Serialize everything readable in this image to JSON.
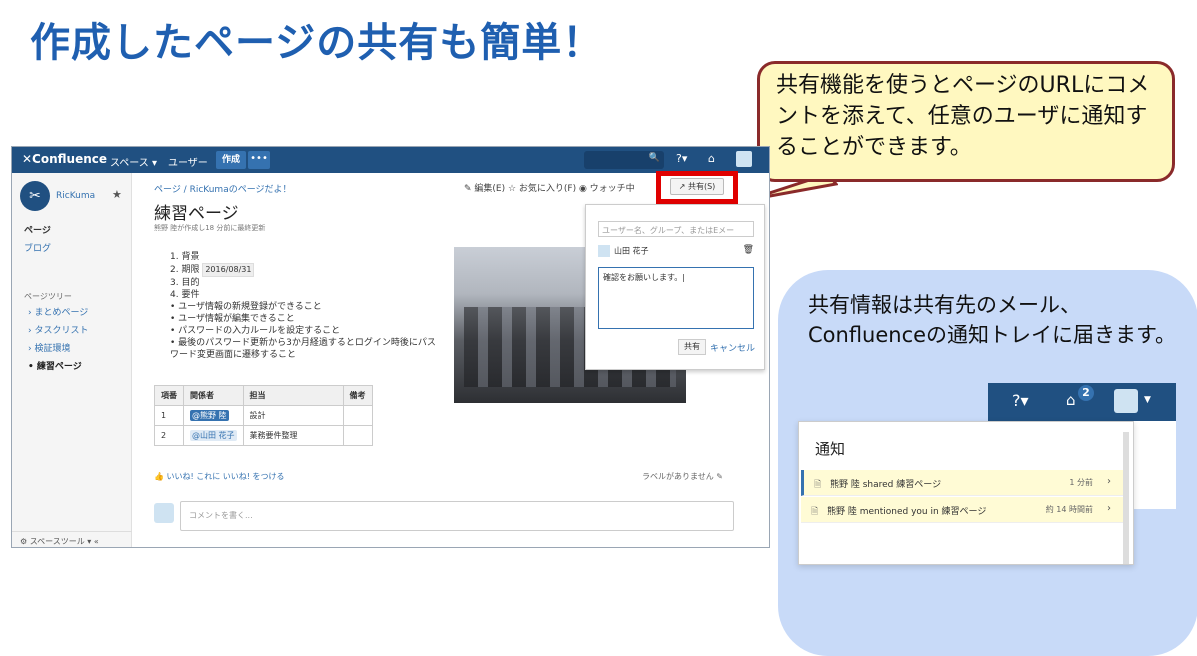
{
  "slide": {
    "title": "作成したページの共有も簡単！",
    "callout": "共有機能を使うとページのURLにコメントを添えて、任意のユーザに通知することができます。",
    "panel_text": "共有情報は共有先のメール、Confluenceの通知トレイに届きます。"
  },
  "topbar": {
    "logo": "✕Confluence",
    "spaces": "スペース ▾",
    "users": "ユーザー",
    "create": "作成",
    "more": "•••",
    "search_icon": "🔍",
    "help": "?▾",
    "notif": "⌂"
  },
  "sidebar": {
    "space_name": "RicKuma",
    "pages": "ページ",
    "blog": "ブログ",
    "tree_title": "ページツリー",
    "tree": [
      "› まとめページ",
      "› タスクリスト",
      "› 検証環境",
      "• 練習ページ"
    ],
    "footer": "⚙ スペースツール ▾   «"
  },
  "content": {
    "breadcrumb": "ページ / RicKumaのページだよ！",
    "actions": "✎ 編集(E)     ☆ お気に入り(F)     ◉ ウォッチ中",
    "share_label": "↗ 共有(S)",
    "title": "練習ページ",
    "byline": "熊野 陸が作成し18 分前に最終更新",
    "ol": [
      "1. 背景",
      "2. 期限",
      "3. 目的",
      "4. 要件"
    ],
    "date": "2016/08/31",
    "ul": [
      "• ユーザ情報の新規登録ができること",
      "• ユーザ情報が編集できること",
      "• パスワードの入力ルールを設定すること",
      "• 最後のパスワード更新から3か月経過するとログイン時後にパスワード変更画面に遷移すること"
    ],
    "table": {
      "headers": [
        "項番",
        "関係者",
        "担当",
        "備考"
      ],
      "rows": [
        {
          "no": "1",
          "person": "@熊野 陸",
          "role": "設計",
          "note": ""
        },
        {
          "no": "2",
          "person": "@山田 花子",
          "role": "業務要件整理",
          "note": ""
        }
      ]
    },
    "likes": "👍 いいね!   これに いいね! をつける",
    "labels": "ラベルがありません ✎",
    "comment_placeholder": "コメントを書く..."
  },
  "share_popup": {
    "input_placeholder": "ユーザー名、グループ、またはEメー",
    "recipient": "山田 花子",
    "trash": "🗑",
    "note": "確認をお願いします。|",
    "submit": "共有",
    "cancel": "キャンセル"
  },
  "notifications": {
    "count": "2",
    "heading": "通知",
    "items": [
      {
        "text": "熊野 陸 shared 練習ページ",
        "time": "1 分前"
      },
      {
        "text": "熊野 陸 mentioned you in 練習ページ",
        "time": "約 14 時間前"
      }
    ]
  }
}
